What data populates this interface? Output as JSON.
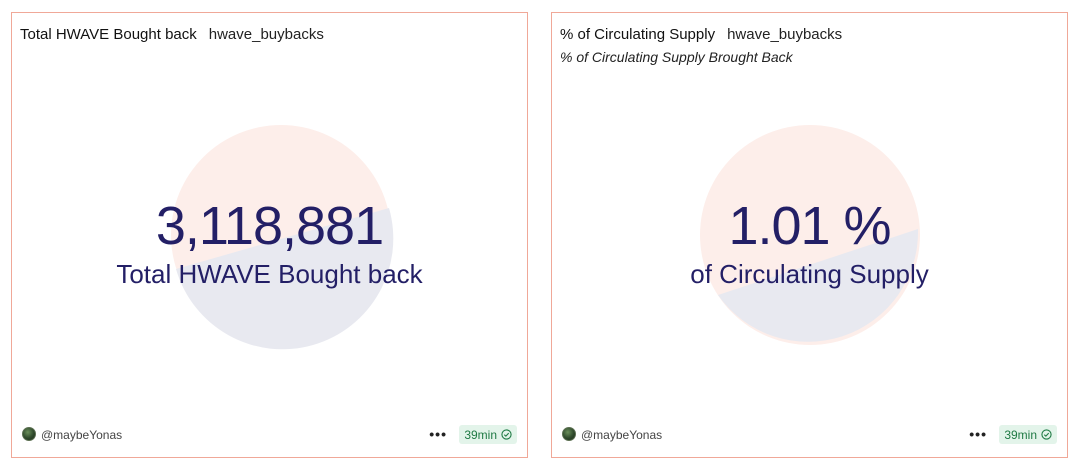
{
  "colors": {
    "card_border": "#f0a898",
    "counter_text": "#231f66",
    "pie_top": "#fdeeea",
    "pie_bottom": "#e8e9f0",
    "freshness_bg": "#e3f4ea",
    "freshness_text": "#1f7a44"
  },
  "cards": [
    {
      "title": "Total HWAVE Bought back",
      "query": "hwave_buybacks",
      "subtitle": "",
      "counter_value": "3,118,881",
      "counter_label": "Total HWAVE Bought back",
      "author": "@maybeYonas",
      "more_icon": "ellipsis-icon",
      "freshness": "39min",
      "freshness_icon": "check-circle-icon"
    },
    {
      "title": "% of Circulating Supply",
      "query": "hwave_buybacks",
      "subtitle": "% of Circulating Supply Brought Back",
      "counter_value": "1.01 %",
      "counter_label": "of Circulating Supply",
      "author": "@maybeYonas",
      "more_icon": "ellipsis-icon",
      "freshness": "39min",
      "freshness_icon": "check-circle-icon"
    }
  ]
}
